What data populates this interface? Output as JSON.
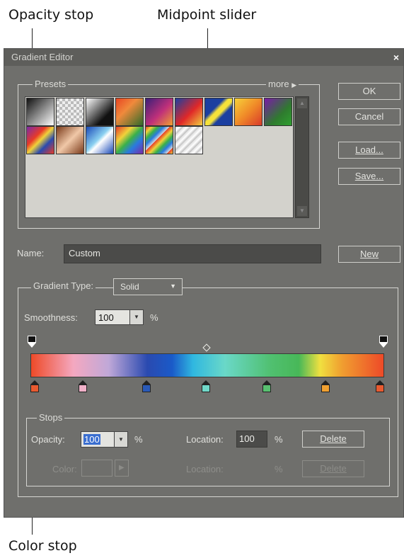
{
  "annotations": {
    "opacity_stop": "Opacity stop",
    "midpoint_slider": "Midpoint slider",
    "color_stop": "Color stop"
  },
  "window": {
    "title": "Gradient Editor",
    "close": "×"
  },
  "presets": {
    "label": "Presets",
    "more": "more",
    "row1": [
      "linear-gradient(135deg,#111 0%,#fff 100%)",
      "repeating-conic-gradient(#eee 0% 25%,#bbb 0% 50%) 0 0/8px 8px",
      "linear-gradient(135deg,#fff 0%,#111 70%)",
      "linear-gradient(135deg,#e84522 0%,#f08a3c 40%,#2f6a2a 100%)",
      "linear-gradient(135deg,#3a1f78 0%,#c0307a 55%,#f0a030 100%)",
      "linear-gradient(135deg,#1b3fa0 0%,#e02828 55%,#f0d040 100%)",
      "linear-gradient(135deg,#1b3fa0 0%,#1b3fa0 35%,#f6e23a 45%,#f6e23a 55%,#1b3fa0 65%)",
      "linear-gradient(135deg,#f7d23a 0%,#f08a28 50%,#d83a2a 100%)",
      "linear-gradient(135deg,#7a1aa8 0%,#2f7a2f 60%,#2fa02f 100%)"
    ],
    "row2": [
      "linear-gradient(135deg,#7a2aa8 0%,#e83a28 35%,#f0d23a 50%,#2a4ab0 70%,#e83a28 100%)",
      "linear-gradient(135deg,#7a3a1a 0%,#f0c8a8 50%,#7a3a1a 100%)",
      "linear-gradient(135deg,#1a4ab8 0%,#8ad0f0 45%,#ffffff 55%,#1a4ab8 100%)",
      "linear-gradient(135deg,#e83a28 0%,#f0d23a 30%,#3ab04a 50%,#2a7ae0 70%,#7a2aa8 100%)",
      "repeating-linear-gradient(135deg,#e83a28 0,#f0d23a 6px,#3ab04a 12px,#2a7ae0 18px,#ddd 24px)",
      "repeating-linear-gradient(135deg,#ddd 0,#fff 4px,#bbb 8px)"
    ]
  },
  "buttons": {
    "ok": "OK",
    "cancel": "Cancel",
    "load": "Load...",
    "save": "Save...",
    "new": "New"
  },
  "name": {
    "label": "Name:",
    "value": "Custom"
  },
  "gradient_type": {
    "label": "Gradient Type:",
    "value": "Solid"
  },
  "smoothness": {
    "label": "Smoothness:",
    "value": "100",
    "unit": "%"
  },
  "gradient_bar": {
    "css": "linear-gradient(90deg,#ee4a28 0%,#f4a8c0 12%,#c0a8d8 22%,#2a4ab0 33%,#1a5ac8 40%,#30b8e0 46%,#6ad8c8 55%,#50c070 68%,#48b858 76%,#f0e040 82%,#f0a030 88%,#ee4a28 100%)"
  },
  "color_stops": [
    {
      "pos": 0,
      "color": "#e85a30"
    },
    {
      "pos": 0.147,
      "color": "#f0b0c8"
    },
    {
      "pos": 0.328,
      "color": "#2a5ab8"
    },
    {
      "pos": 0.495,
      "color": "#70d8c8"
    },
    {
      "pos": 0.668,
      "color": "#58c070"
    },
    {
      "pos": 0.834,
      "color": "#f0a030"
    },
    {
      "pos": 1,
      "color": "#e85a30"
    }
  ],
  "stops": {
    "label": "Stops",
    "opacity_label": "Opacity:",
    "opacity_value": "100",
    "opacity_unit": "%",
    "location_label": "Location:",
    "location_value": "100",
    "location_unit": "%",
    "delete": "Delete",
    "color_label": "Color:",
    "location2_label": "Location:",
    "location2_unit": "%",
    "delete2": "Delete"
  }
}
